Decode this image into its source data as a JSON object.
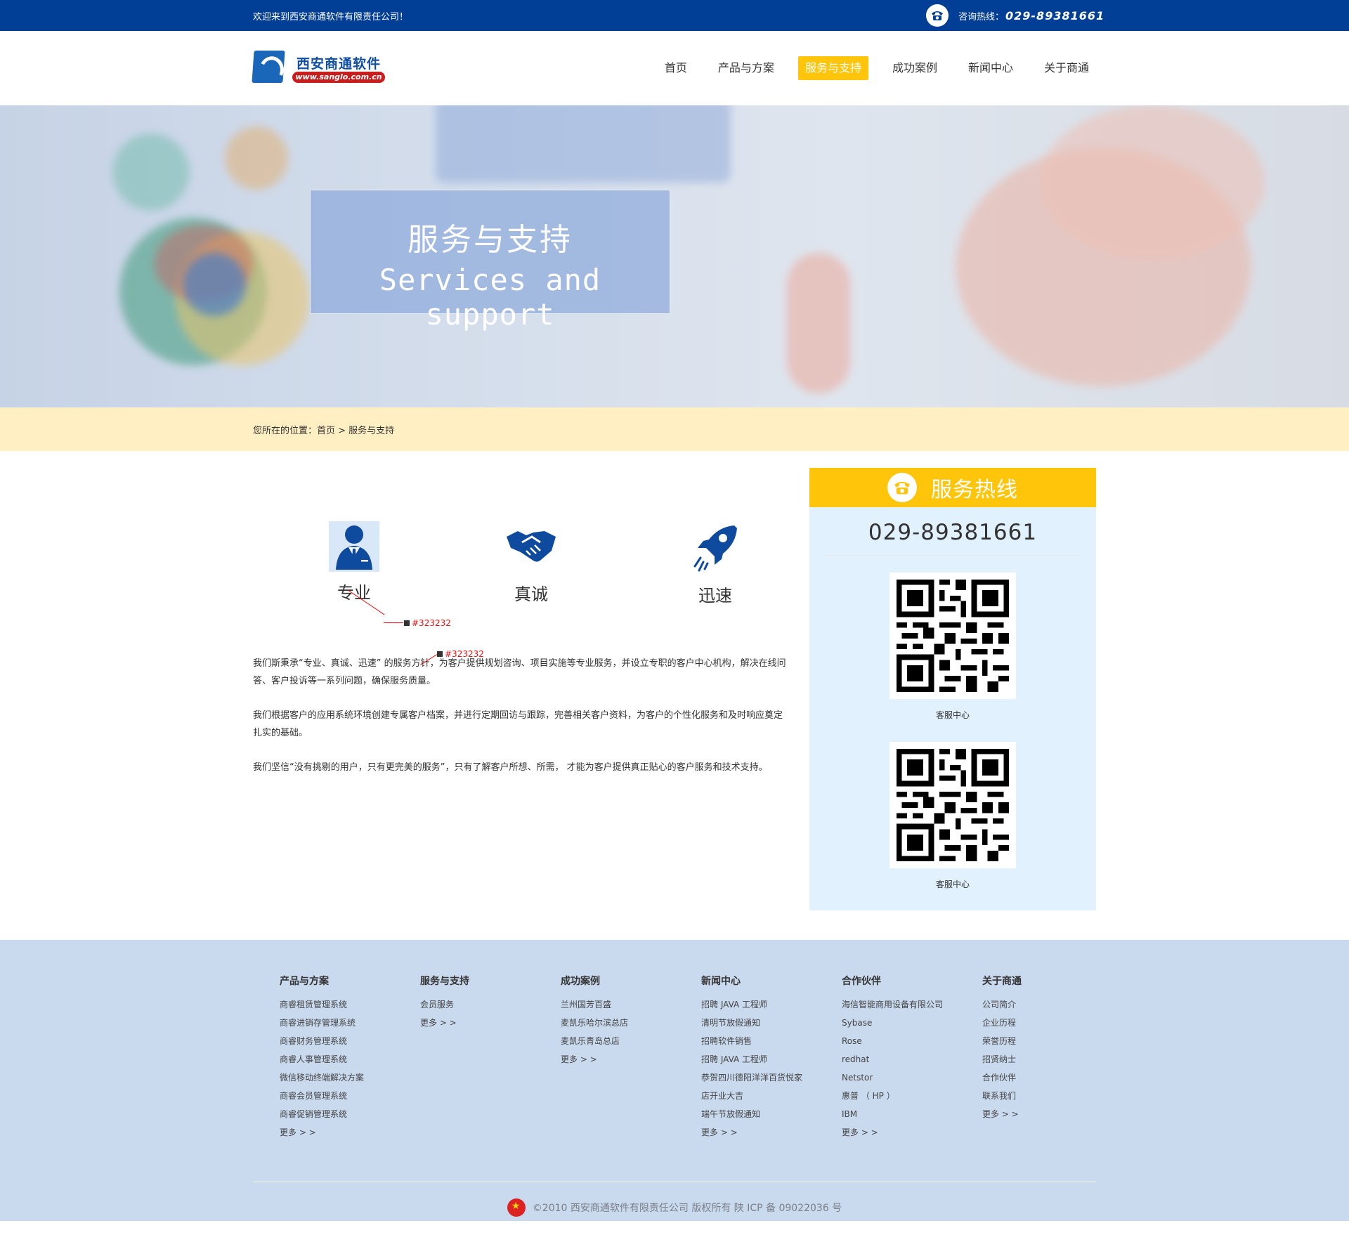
{
  "topbar": {
    "welcome": "欢迎来到西安商通软件有限责任公司！",
    "hotline_label": "咨询热线：",
    "hotline_number": "029-89381661"
  },
  "logo": {
    "name": "西安商通软件",
    "url": "www.sanglo.com.cn"
  },
  "nav": [
    {
      "label": "首页",
      "active": false
    },
    {
      "label": "产品与方案",
      "active": false
    },
    {
      "label": "服务与支持",
      "active": true
    },
    {
      "label": "成功案例",
      "active": false
    },
    {
      "label": "新闻中心",
      "active": false
    },
    {
      "label": "关于商通",
      "active": false
    }
  ],
  "banner": {
    "title_cn": "服务与支持",
    "title_en": "Services and support"
  },
  "breadcrumb": "您所在的位置：首页 > 服务与支持",
  "features": [
    {
      "label": "专业",
      "icon": "business-person-icon"
    },
    {
      "label": "真诚",
      "icon": "handshake-icon"
    },
    {
      "label": "迅速",
      "icon": "rocket-icon"
    }
  ],
  "paragraphs": [
    "我们斯秉承“专业、真诚、迅速” 的服务方针，为客户提供规划咨询、项目实施等专业服务，并设立专职的客户中心机构，解决在线问答、客户投诉等一系列问题，确保服务质量。",
    "我们根据客户的应用系统环境创建专属客户档案，并进行定期回访与跟踪，完善相关客户资料，为客户的个性化服务和及时响应奠定扎实的基础。",
    "我们坚信“没有挑剔的用户，只有更完美的服务”，只有了解客户所想、所需， 才能为客户提供真正贴心的客户服务和技术支持。"
  ],
  "annotations": {
    "a1": "#ffc50a",
    "a2": "#323232",
    "a3": "#e8e8e8",
    "a4": "#e1f1fe",
    "a5": "#323232",
    "a6": "#323232"
  },
  "sidebar": {
    "title": "服务热线",
    "phone": "029-89381661",
    "qr_captions": [
      "客服中心",
      "客服中心"
    ]
  },
  "footer": {
    "columns": [
      {
        "title": "产品与方案",
        "items": [
          "商睿租赁管理系统",
          "商睿进销存管理系统",
          "商睿财务管理系统",
          "商睿人事管理系统",
          "微信移动终端解决方案",
          "商睿会员管理系统",
          "商睿促销管理系统",
          "更多 > >"
        ]
      },
      {
        "title": "服务与支持",
        "items": [
          "会员服务",
          "更多 > >"
        ]
      },
      {
        "title": "成功案例",
        "items": [
          "兰州国芳百盛",
          "麦凯乐哈尔滨总店",
          "麦凯乐青岛总店",
          "更多 > >"
        ]
      },
      {
        "title": "新闻中心",
        "items": [
          "招聘 JAVA 工程师",
          "清明节放假通知",
          "招聘软件销售",
          "招聘 JAVA 工程师",
          "恭贺四川德阳洋洋百货悦家",
          "店开业大吉",
          "端午节放假通知",
          "更多 > >"
        ]
      },
      {
        "title": "合作伙伴",
        "items": [
          "海信智能商用设备有限公司",
          "Sybase",
          "Rose",
          "redhat",
          "Netstor",
          "惠普 （ HP ）",
          "IBM",
          "更多 > >"
        ]
      },
      {
        "title": "关于商通",
        "items": [
          "公司简介",
          "企业历程",
          "荣誉历程",
          "招贤纳士",
          "合作伙伴",
          "联系我们",
          "更多 > >"
        ]
      }
    ],
    "copyright": "©2010 西安商通软件有限责任公司 版权所有    陕 ICP 备 09022036 号"
  },
  "colors": {
    "topbar": "#003f95",
    "accent": "#ffc50a",
    "text": "#323232",
    "sidebar_bg": "#e1f1fe",
    "divider": "#e8e8e8",
    "crumb_bg": "#ffefc2",
    "footer_bg": "#c9d9ee",
    "icon_blue": "#0e4a9e"
  }
}
